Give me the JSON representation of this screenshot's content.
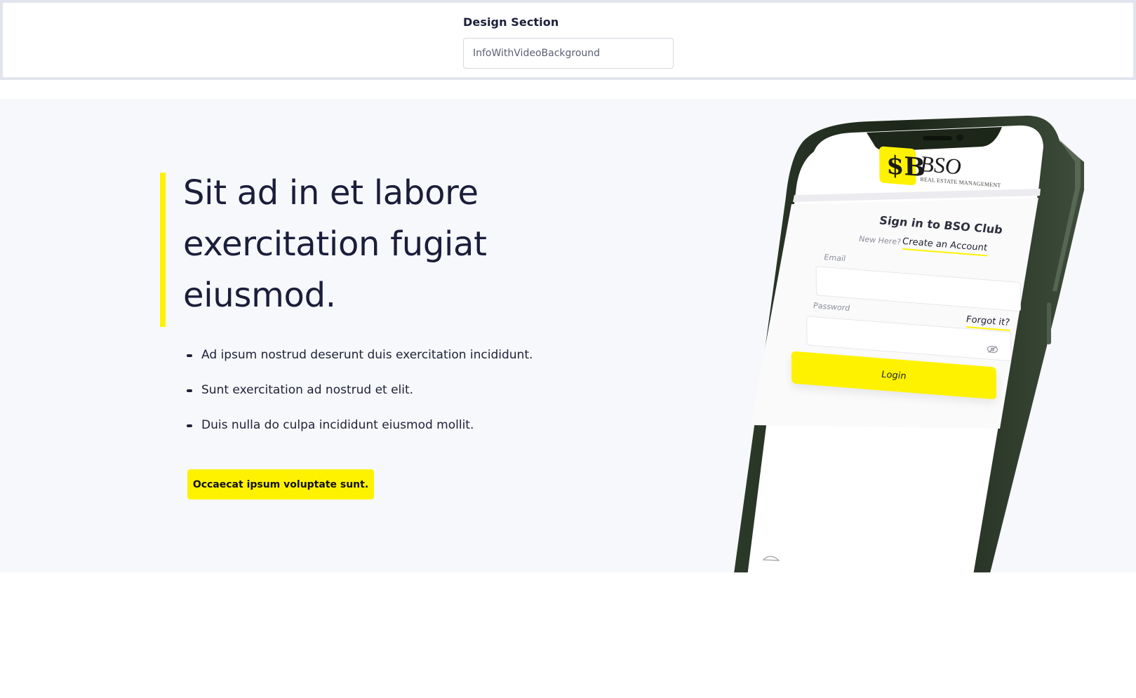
{
  "design_section": {
    "label": "Design Section",
    "input_value": "InfoWithVideoBackground"
  },
  "hero": {
    "title": "Sit ad in et labore exercitation fugiat eiusmod.",
    "bullets": [
      "Ad ipsum nostrud deserunt duis exercitation incididunt.",
      "Sunt exercitation ad nostrud et elit.",
      "Duis nulla do culpa incididunt eiusmod mollit."
    ],
    "cta_label": "Occaecat ipsum voluptate sunt.",
    "accent_color": "#fff200"
  },
  "phone": {
    "brand_mark": "$B",
    "brand_name": "BSO",
    "brand_sub": "REAL ESTATE MANAGEMENT",
    "signin_title": "Sign in to BSO Club",
    "new_here": "New Here?",
    "create_account": "Create an Account",
    "email_label": "Email",
    "password_label": "Password",
    "forgot_label": "Forgot it?",
    "login_label": "Login"
  }
}
